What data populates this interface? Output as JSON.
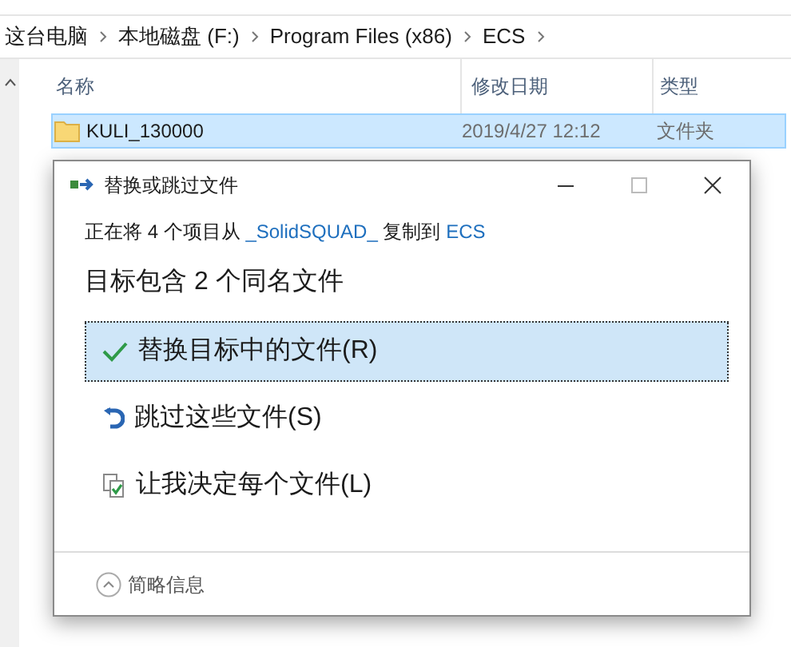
{
  "breadcrumb": [
    {
      "label": "这台电脑"
    },
    {
      "label": "本地磁盘 (F:)"
    },
    {
      "label": "Program Files (x86)"
    },
    {
      "label": "ECS"
    }
  ],
  "columns": [
    {
      "label": "名称"
    },
    {
      "label": "修改日期"
    },
    {
      "label": "类型"
    }
  ],
  "files": [
    {
      "name": "KULI_130000",
      "modified": "2019/4/27 12:12",
      "type": "文件夹",
      "selected": true
    }
  ],
  "dialog": {
    "title": "替换或跳过文件",
    "message": [
      {
        "kind": "text",
        "text": "正在将 4 个项目从 "
      },
      {
        "kind": "link",
        "text": "_SolidSQUAD_"
      },
      {
        "kind": "text",
        "text": " 复制到 "
      },
      {
        "kind": "link",
        "text": "ECS"
      }
    ],
    "heading": "目标包含 2 个同名文件",
    "options": [
      {
        "kind": "replace",
        "label": "替换目标中的文件(R)",
        "selected": true
      },
      {
        "kind": "skip",
        "label": "跳过这些文件(S)",
        "selected": false
      },
      {
        "kind": "decide",
        "label": "让我决定每个文件(L)",
        "selected": false
      }
    ],
    "details_button": "简略信息"
  }
}
